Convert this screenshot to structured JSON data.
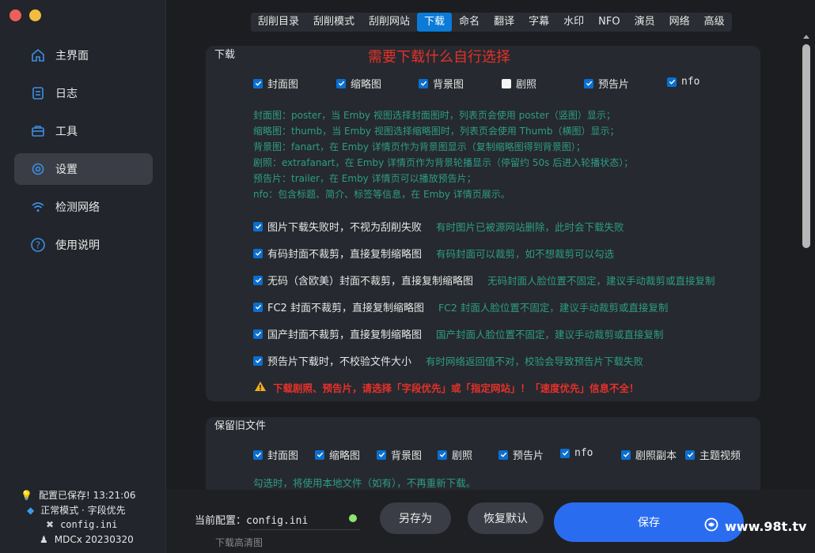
{
  "sidebar": {
    "items": [
      {
        "label": "主界面",
        "icon": "home-icon"
      },
      {
        "label": "日志",
        "icon": "log-icon"
      },
      {
        "label": "工具",
        "icon": "toolbox-icon"
      },
      {
        "label": "设置",
        "icon": "settings-icon",
        "active": true
      },
      {
        "label": "检测网络",
        "icon": "wifi-icon"
      },
      {
        "label": "使用说明",
        "icon": "help-icon"
      }
    ],
    "status": {
      "saved": "配置已保存! 13:21:06",
      "mode": "正常模式 · 字段优先",
      "config": "config.ini",
      "version": "MDCx 20230320"
    }
  },
  "tabs": [
    "刮削目录",
    "刮削模式",
    "刮削网站",
    "下载",
    "命名",
    "翻译",
    "字幕",
    "水印",
    "NFO",
    "演员",
    "网络",
    "高级"
  ],
  "active_tab": "下载",
  "download": {
    "title": "下载",
    "hint": "需要下载什么自行选择",
    "options": [
      {
        "label": "封面图",
        "checked": true
      },
      {
        "label": "缩略图",
        "checked": true
      },
      {
        "label": "背景图",
        "checked": true
      },
      {
        "label": "剧照",
        "checked": false
      },
      {
        "label": "预告片",
        "checked": true
      },
      {
        "label": "nfo",
        "checked": true
      }
    ],
    "descriptions": [
      "封面图：poster，当 Emby 视图选择封面图时，列表页会使用 poster（竖图）显示；",
      "缩略图：thumb，当 Emby 视图选择缩略图时，列表页会使用 Thumb（横图）显示；",
      "背景图：fanart，在 Emby 详情页作为背景图显示（复制缩略图得到背景图）；",
      "剧照：extrafanart，在 Emby 详情页作为背景轮播显示（停留约 50s 后进入轮播状态）；",
      "预告片：trailer，在 Emby 详情页可以播放预告片；",
      "nfo：包含标题、简介、标签等信息，在 Emby 详情页展示。"
    ],
    "settings": [
      {
        "label": "图片下载失败时，不视为刮削失败",
        "note": "有时图片已被源网站删除，此时会下载失败"
      },
      {
        "label": "有码封面不裁剪，直接复制缩略图",
        "note": "有码封面可以裁剪，如不想裁剪可以勾选"
      },
      {
        "label": "无码（含欧美）封面不裁剪，直接复制缩略图",
        "note": "无码封面人脸位置不固定，建议手动裁剪或直接复制"
      },
      {
        "label": "FC2 封面不裁剪，直接复制缩略图",
        "note": "FC2 封面人脸位置不固定，建议手动裁剪或直接复制"
      },
      {
        "label": "国产封面不裁剪，直接复制缩略图",
        "note": "国产封面人脸位置不固定，建议手动裁剪或直接复制"
      },
      {
        "label": "预告片下载时，不校验文件大小",
        "note": "有时网络返回值不对，校验会导致预告片下载失败"
      }
    ],
    "warning": "下载剧照、预告片，请选择「字段优先」或「指定网站」！「速度优先」信息不全！"
  },
  "keep_old": {
    "title": "保留旧文件",
    "options": [
      "封面图",
      "缩略图",
      "背景图",
      "剧照",
      "预告片",
      "nfo",
      "剧照副本",
      "主题视频"
    ],
    "desc": "勾选时，将使用本地文件（如有），不再重新下载。"
  },
  "bottom": {
    "current_label": "当前配置：",
    "current_value": "config.ini",
    "save_as": "另存为",
    "restore": "恢复默认",
    "save": "保存",
    "watermark": "www.98t.tv",
    "ghost_label": "下载高清图"
  },
  "colors": {
    "accent": "#2a6cf0",
    "tab_active": "#0a7bd8",
    "teal": "#2d9d86",
    "red": "#e5312b"
  }
}
